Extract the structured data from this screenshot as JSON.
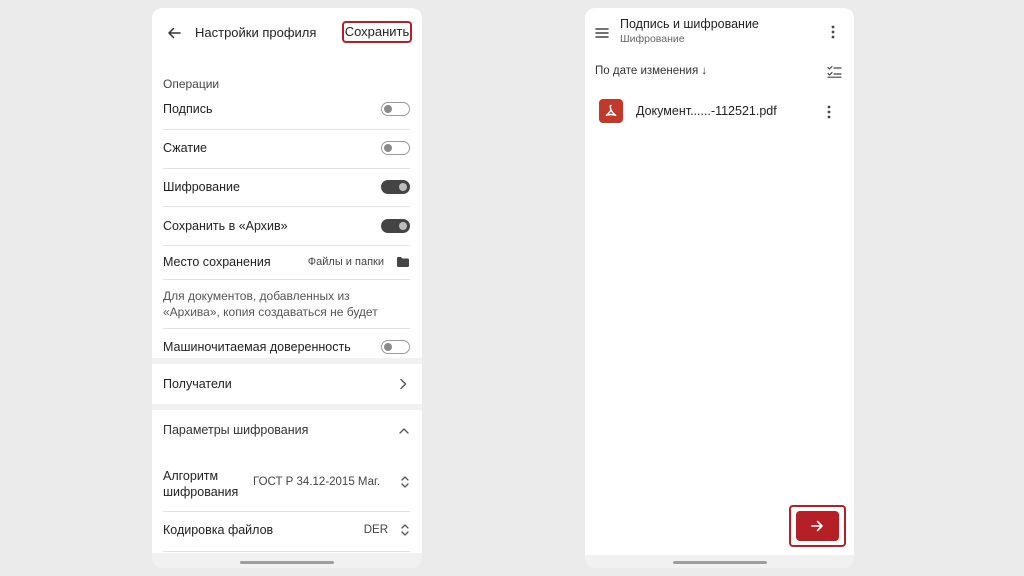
{
  "left_screen": {
    "header": {
      "title": "Настройки профиля",
      "save_label": "Сохранить"
    },
    "operations": {
      "section_label": "Операции",
      "items": [
        {
          "label": "Подпись",
          "enabled": false
        },
        {
          "label": "Сжатие",
          "enabled": false
        },
        {
          "label": "Шифрование",
          "enabled": true
        },
        {
          "label": "Сохранить в «Архив»",
          "enabled": true
        }
      ],
      "save_location": {
        "label": "Место сохранения",
        "value": "Файлы и папки",
        "icon": "folder-icon"
      },
      "note": "Для документов, добавленных из «Архива», копия создаваться не будет",
      "machine_readable": {
        "label": "Машиночитаемая доверенность",
        "enabled": false
      }
    },
    "recipients": {
      "label": "Получатели",
      "icon": "chevron-right-icon"
    },
    "encryption_params": {
      "section_label": "Параметры шифрования",
      "algorithm": {
        "label_line1": "Алгоритм",
        "label_line2": "шифрования",
        "value": "ГОСТ Р 34.12-2015 Маг."
      },
      "file_encoding": {
        "label": "Кодировка файлов",
        "value": "DER"
      }
    }
  },
  "right_screen": {
    "header": {
      "title": "Подпись и шифрование",
      "subtitle": "Шифрование"
    },
    "sort": {
      "label": "По дате изменения ↓",
      "icon": "checklist-icon"
    },
    "files": [
      {
        "name": "Документ......-112521.pdf",
        "icon": "pdf-icon"
      }
    ],
    "fab": {
      "icon": "arrow-right-icon"
    }
  },
  "colors": {
    "accent": "#b52028",
    "toggle_on": "#444444",
    "background": "#ebebeb"
  }
}
